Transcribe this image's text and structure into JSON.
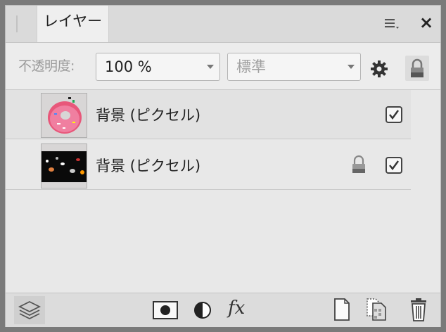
{
  "panel": {
    "tab_title": "レイヤー",
    "menu_icon": "hamburger-menu-icon",
    "close_icon": "close-icon",
    "close_glyph": "×"
  },
  "toolbar": {
    "opacity_label": "不透明度:",
    "opacity_value": "100 %",
    "blend_mode": "標準",
    "gear_icon": "gear-icon",
    "lock_icon": "lock-icon"
  },
  "layers": [
    {
      "name": "背景 (ピクセル)",
      "thumbnail": "donut-image",
      "locked": false,
      "visible": true
    },
    {
      "name": "背景 (ピクセル)",
      "thumbnail": "dark-sprinkles-image",
      "locked": true,
      "visible": true
    }
  ],
  "bottom_toolbar": {
    "icons": [
      "layers-stack-icon",
      "mask-icon",
      "adjustment-icon",
      "fx-icon",
      "new-layer-icon",
      "duplicate-layer-icon",
      "trash-icon"
    ],
    "fx_label": "fx"
  }
}
